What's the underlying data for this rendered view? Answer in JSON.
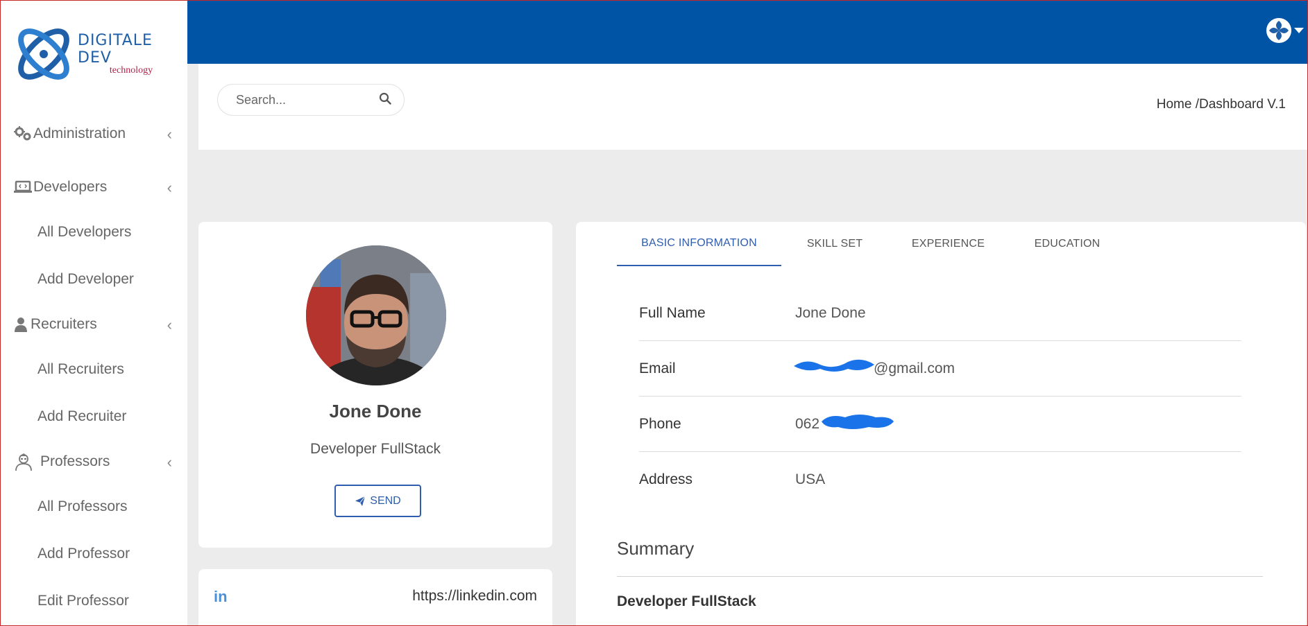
{
  "brand": {
    "title": "DIGITALE DEV",
    "subtitle": "technology"
  },
  "sidebar": {
    "sections": [
      {
        "label": "Administration",
        "icon": "gears-icon"
      },
      {
        "label": "Developers",
        "icon": "laptop-code-icon",
        "items": [
          "All Developers",
          "Add Developer"
        ]
      },
      {
        "label": "Recruiters",
        "icon": "user-tie-icon",
        "items": [
          "All Recruiters",
          "Add Recruiter"
        ]
      },
      {
        "label": "Professors",
        "icon": "professor-icon",
        "items": [
          "All Professors",
          "Add Professor",
          "Edit Professor"
        ]
      }
    ]
  },
  "search": {
    "placeholder": "Search..."
  },
  "breadcrumb": "Home /Dashboard V.1",
  "profile": {
    "name": "Jone Done",
    "role": "Developer FullStack",
    "send_label": "SEND",
    "linkedin_icon": "in",
    "linkedin_url": "https://linkedin.com"
  },
  "tabs": [
    "BASIC INFORMATION",
    "SKILL SET",
    "EXPERIENCE",
    "EDUCATION"
  ],
  "basic_info": {
    "rows": [
      {
        "label": "Full Name",
        "value": "Jone Done"
      },
      {
        "label": "Email",
        "value": "@gmail.com"
      },
      {
        "label": "Phone",
        "value": "062"
      },
      {
        "label": "Address",
        "value": "USA"
      }
    ]
  },
  "summary": {
    "title": "Summary",
    "subtitle": "Developer FullStack"
  },
  "colors": {
    "topbar": "#0054a6",
    "accent": "#2f5dad",
    "redaction": "#1a73e8"
  }
}
